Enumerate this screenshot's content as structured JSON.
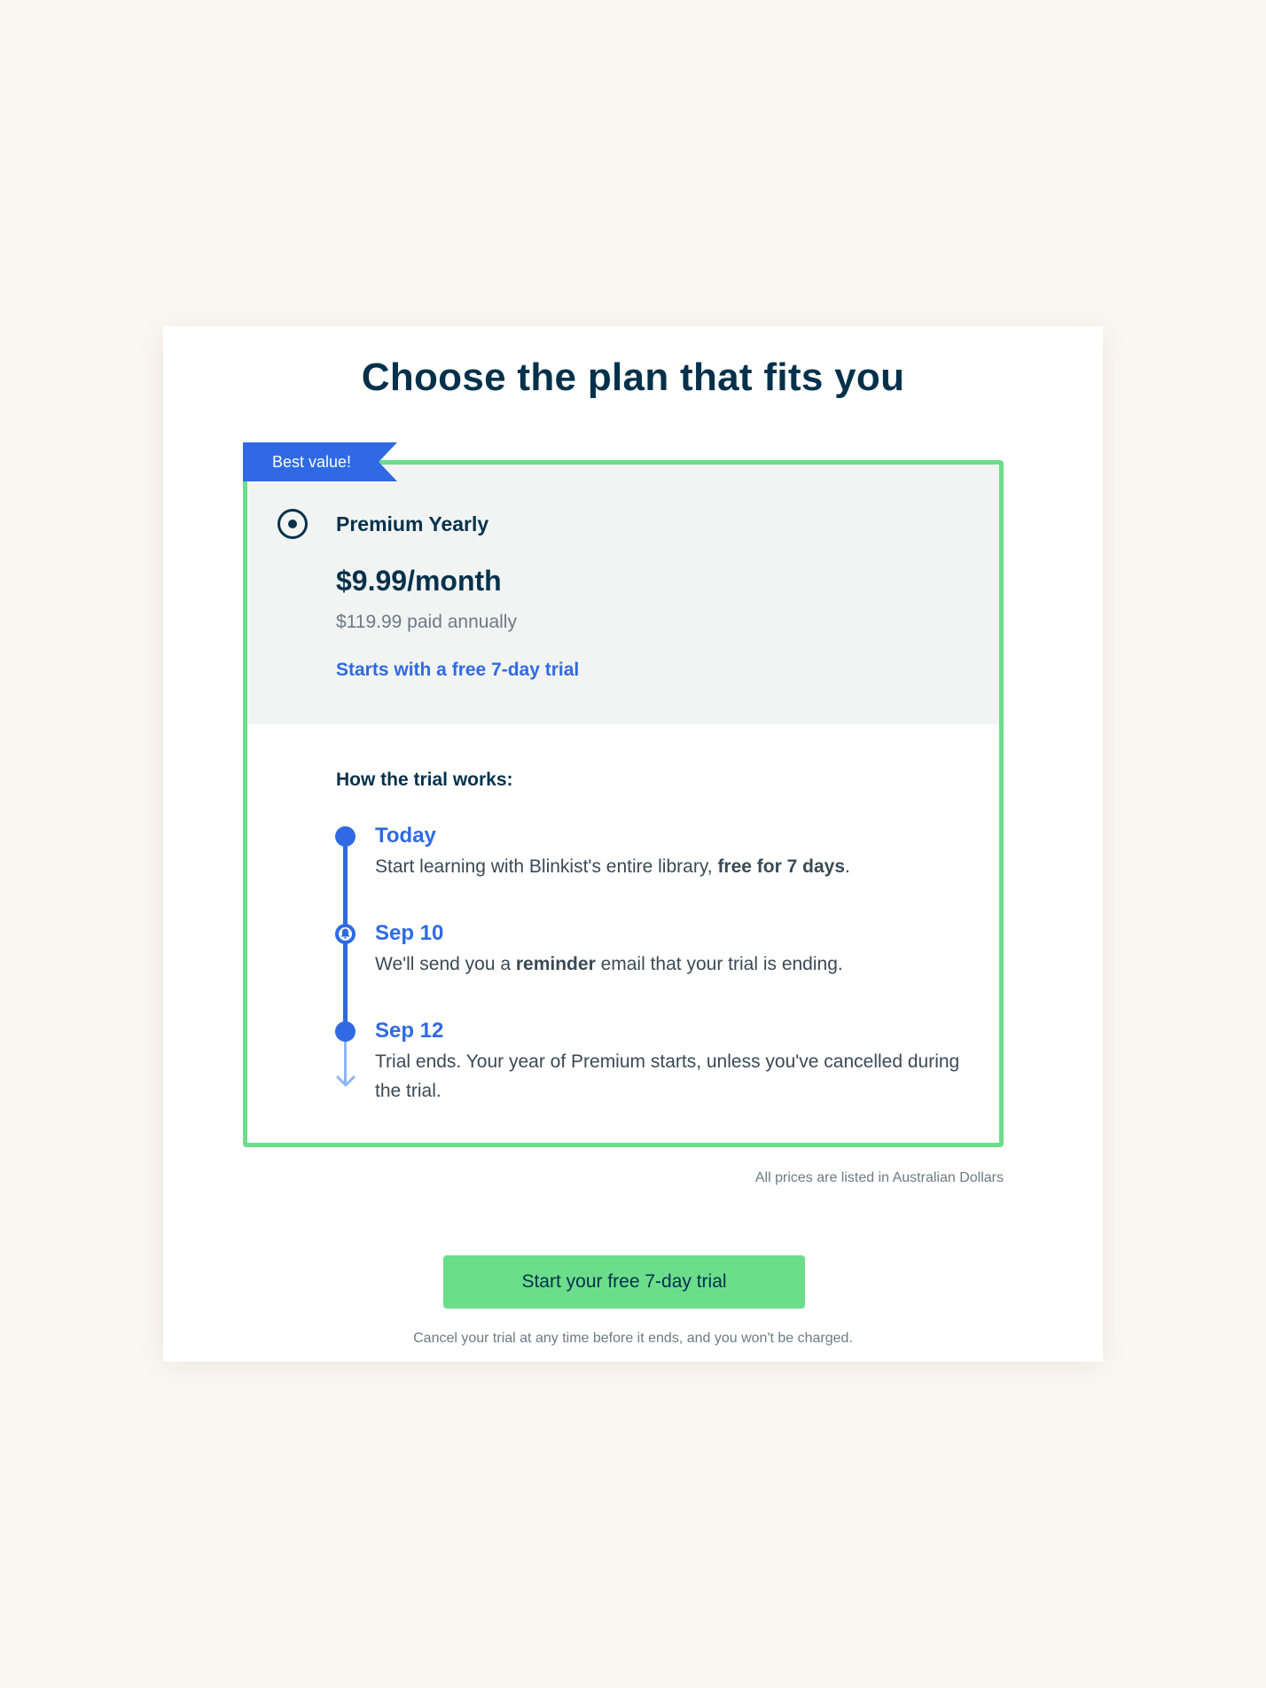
{
  "page": {
    "title": "Choose the plan that fits you"
  },
  "plan": {
    "badge": "Best value!",
    "name": "Premium Yearly",
    "price": "$9.99/month",
    "annual": "$119.99 paid annually",
    "trial_note": "Starts with a free 7-day trial",
    "selected": true
  },
  "trial": {
    "heading": "How the trial works:",
    "steps": [
      {
        "date": "Today",
        "text_before": "Start learning with Blinkist's entire library, ",
        "text_bold": "free for 7 days",
        "text_after": "."
      },
      {
        "date": "Sep 10",
        "text_before": "We'll send you a ",
        "text_bold": "reminder",
        "text_after": " email that your trial is ending."
      },
      {
        "date": "Sep 12",
        "text_before": "Trial ends. Your year of Premium starts, unless you've cancelled during the trial.",
        "text_bold": "",
        "text_after": ""
      }
    ]
  },
  "currency_note": "All prices are listed in Australian Dollars",
  "cta": {
    "label": "Start your free 7-day trial"
  },
  "cancel_note": "Cancel your trial at any time before it ends, and you won't be charged.",
  "colors": {
    "page_bg": "#faf7f1",
    "brand_blue": "#2f6ae4",
    "accent_green": "#6bdd8b",
    "text_dark": "#03314b"
  },
  "icons": {
    "radio": "radio-selected-icon",
    "step_marker": "timeline-dot-icon",
    "reminder": "bell-icon",
    "continue": "arrow-down-icon"
  }
}
